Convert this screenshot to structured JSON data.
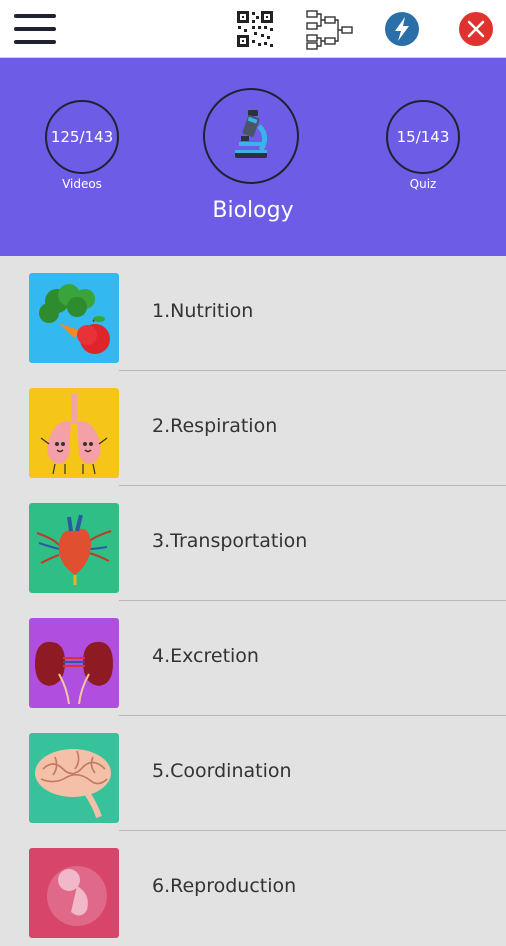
{
  "toolbar": {
    "menu_icon": "hamburger-menu-icon",
    "qr_icon": "qr-code-icon",
    "tree_icon": "hierarchy-tree-icon",
    "flash_icon": "lightning-bolt-icon",
    "close_icon": "close-icon",
    "flash_color": "#2a6fa8",
    "close_color": "#e0322e"
  },
  "hero": {
    "background": "#6d5ce6",
    "videos": {
      "count": "125/143",
      "label": "Videos"
    },
    "quiz": {
      "count": "15/143",
      "label": "Quiz"
    },
    "subject_icon": "microscope-icon",
    "subject": "Biology"
  },
  "chapters": [
    {
      "label": "1.Nutrition",
      "thumb_icon": "vegetables-fruit-icon",
      "thumb_color": "#33b8f0"
    },
    {
      "label": "2.Respiration",
      "thumb_icon": "lungs-icon",
      "thumb_color": "#f5c518"
    },
    {
      "label": "3.Transportation",
      "thumb_icon": "heart-icon",
      "thumb_color": "#2fbf86"
    },
    {
      "label": "4.Excretion",
      "thumb_icon": "kidneys-icon",
      "thumb_color": "#b04ee0"
    },
    {
      "label": "5.Coordination",
      "thumb_icon": "brain-icon",
      "thumb_color": "#37c29c"
    },
    {
      "label": "6.Reproduction",
      "thumb_icon": "fetus-icon",
      "thumb_color": "#d8456b"
    }
  ]
}
